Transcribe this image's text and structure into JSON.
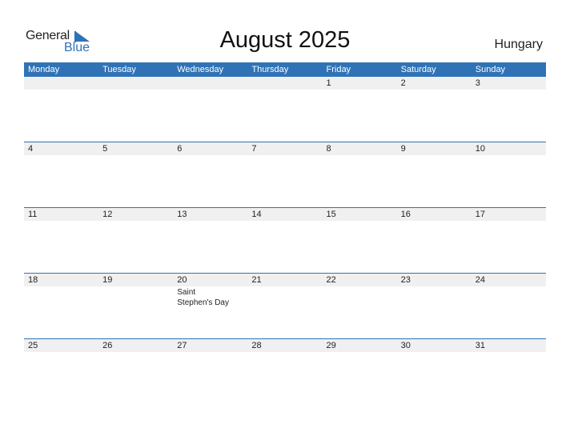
{
  "logo": {
    "general": "General",
    "blue": "Blue",
    "accent": "#2f73b6"
  },
  "title": "August 2025",
  "country": "Hungary",
  "weekdays": [
    "Monday",
    "Tuesday",
    "Wednesday",
    "Thursday",
    "Friday",
    "Saturday",
    "Sunday"
  ],
  "weeks": [
    {
      "days": [
        "",
        "",
        "",
        "",
        "1",
        "2",
        "3"
      ],
      "events": [
        "",
        "",
        "",
        "",
        "",
        "",
        ""
      ]
    },
    {
      "days": [
        "4",
        "5",
        "6",
        "7",
        "8",
        "9",
        "10"
      ],
      "events": [
        "",
        "",
        "",
        "",
        "",
        "",
        ""
      ]
    },
    {
      "days": [
        "11",
        "12",
        "13",
        "14",
        "15",
        "16",
        "17"
      ],
      "events": [
        "",
        "",
        "",
        "",
        "",
        "",
        ""
      ]
    },
    {
      "days": [
        "18",
        "19",
        "20",
        "21",
        "22",
        "23",
        "24"
      ],
      "events": [
        "",
        "",
        "Saint Stephen's Day",
        "",
        "",
        "",
        ""
      ]
    },
    {
      "days": [
        "25",
        "26",
        "27",
        "28",
        "29",
        "30",
        "31"
      ],
      "events": [
        "",
        "",
        "",
        "",
        "",
        "",
        ""
      ]
    }
  ]
}
